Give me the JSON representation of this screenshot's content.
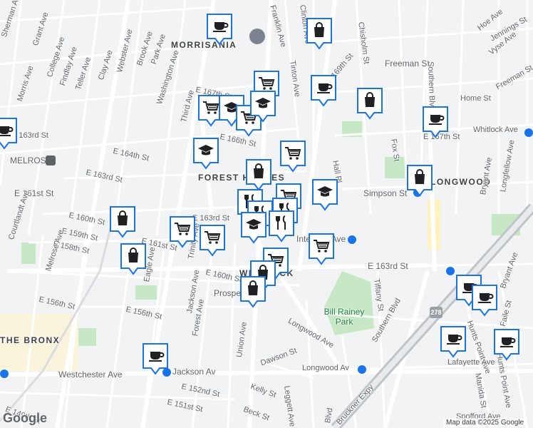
{
  "map": {
    "neighborhoods": [
      "MORRISANIA",
      "FOREST HOUSES",
      "LONGWOOD",
      "WHITLOCK",
      "MELROSE",
      "THE BRONX"
    ],
    "streets": [
      "Franklin Ave",
      "Clinton Ave",
      "Chisholm St",
      "Hoe Ave",
      "Vyse Ave",
      "Jennings St",
      "Sherman Ave",
      "Grant Ave",
      "College Ave",
      "Findlay Ave",
      "Teller Ave",
      "Clay Ave",
      "Webster Ave",
      "Brook Ave",
      "Park Ave",
      "Washington Ave",
      "Third Ave",
      "E 167th St",
      "Tinton Ave",
      "E 169th St",
      "Freeman St",
      "Home St",
      "Simpson St",
      "Fox St",
      "Southern Blvd",
      "Whitlock Ave",
      "E 167th St",
      "Bryant Ave",
      "Longfellow Ave",
      "E 163rd St",
      "Morris Ave",
      "Melrose",
      "E 164th St",
      "E 166th St",
      "E 161st St",
      "E 163rd St",
      "E 160th St",
      "E 159th St",
      "E 158th St",
      "Courtlandt Ave",
      "E 156th St",
      "Melrose Ave",
      "Eagle Ave",
      "E 161st St",
      "E 163rd St",
      "Trinity Ave",
      "Jackson Ave",
      "E 160th St",
      "Prospect Ave",
      "Intervale Ave",
      "E 156th St",
      "Forest Ave",
      "Union Ave",
      "Tiffany St",
      "Longwood Ave",
      "Southern Blvd",
      "Bryant Ave",
      "Faile St",
      "Hunts Point Ave",
      "Westchester Ave",
      "Jackson Av",
      "E 152nd St",
      "Dawson St",
      "Kelly St",
      "E 151st St",
      "Beck St",
      "Leggett Ave",
      "E 149th St",
      "Longwood Av",
      "Lafayette Ave",
      "Manida St",
      "Hunts Point Ave",
      "Bruckner Expy",
      "Spofford Ave",
      "Hall Pl",
      "Freeman St",
      "Fox St",
      "E 163rd St",
      "Blvd"
    ],
    "parks": [
      "Bill Rainey Park"
    ],
    "highway_shield": "278",
    "transit_icons": [
      "subway-icon",
      "subway-icon",
      "subway-icon",
      "subway-icon",
      "subway-icon",
      "subway-icon",
      "train-icon"
    ],
    "attribution": "Map data ©2025 Google",
    "logo": "Google",
    "pins": [
      {
        "type": "cafe",
        "icon": "coffee-cup-icon"
      },
      {
        "type": "shop",
        "icon": "shopping-bag-icon"
      },
      {
        "type": "school",
        "icon": "graduation-cap-icon"
      },
      {
        "type": "grocery",
        "icon": "shopping-cart-icon"
      },
      {
        "type": "cafe",
        "icon": "coffee-cup-icon"
      },
      {
        "type": "shop",
        "icon": "shopping-bag-icon"
      },
      {
        "type": "grocery",
        "icon": "shopping-cart-icon"
      },
      {
        "type": "school",
        "icon": "graduation-cap-icon"
      },
      {
        "type": "grocery",
        "icon": "shopping-cart-icon"
      },
      {
        "type": "school",
        "icon": "graduation-cap-icon"
      },
      {
        "type": "cafe",
        "icon": "coffee-cup-icon"
      },
      {
        "type": "cafe",
        "icon": "coffee-cup-icon"
      },
      {
        "type": "school",
        "icon": "graduation-cap-icon"
      },
      {
        "type": "grocery",
        "icon": "shopping-cart-icon"
      },
      {
        "type": "shop",
        "icon": "shopping-bag-icon"
      },
      {
        "type": "shop",
        "icon": "shopping-bag-icon"
      },
      {
        "type": "restaurant",
        "icon": "fork-knife-icon"
      },
      {
        "type": "grocery",
        "icon": "shopping-cart-icon"
      },
      {
        "type": "restaurant",
        "icon": "fork-knife-icon"
      },
      {
        "type": "restaurant",
        "icon": "fork-knife-icon"
      },
      {
        "type": "school",
        "icon": "graduation-cap-icon"
      },
      {
        "type": "restaurant",
        "icon": "fork-knife-icon"
      },
      {
        "type": "shop",
        "icon": "shopping-bag-icon"
      },
      {
        "type": "grocery",
        "icon": "shopping-cart-icon"
      },
      {
        "type": "grocery",
        "icon": "shopping-cart-icon"
      },
      {
        "type": "grocery",
        "icon": "shopping-cart-icon"
      },
      {
        "type": "shop",
        "icon": "shopping-bag-icon"
      },
      {
        "type": "grocery",
        "icon": "shopping-cart-icon"
      },
      {
        "type": "shop",
        "icon": "shopping-bag-icon"
      },
      {
        "type": "shop",
        "icon": "shopping-bag-icon"
      },
      {
        "type": "cafe",
        "icon": "coffee-cup-icon"
      },
      {
        "type": "cafe",
        "icon": "coffee-cup-icon"
      },
      {
        "type": "cafe",
        "icon": "coffee-cup-icon"
      },
      {
        "type": "cafe",
        "icon": "coffee-cup-icon"
      },
      {
        "type": "cafe",
        "icon": "coffee-cup-icon"
      }
    ],
    "colors": {
      "land": "#f1f3f4",
      "road": "#ffffff",
      "park": "#c6e8c4",
      "water": "#aadaff",
      "pin_fill": "#ffffff",
      "pin_border": "#1a73e8",
      "pin_icon": "#202124",
      "highway": "#9aa0a6"
    }
  }
}
